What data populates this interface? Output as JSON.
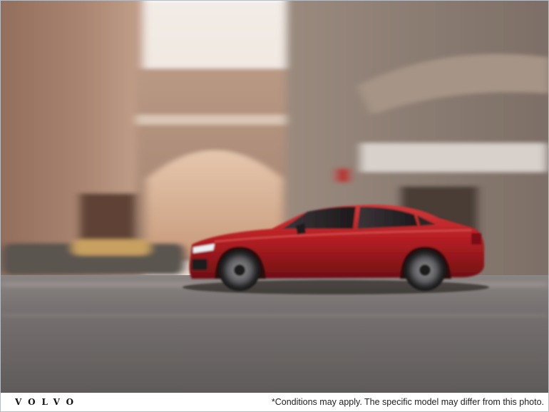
{
  "photo": {
    "subject": "red-sedan-icon",
    "colors": {
      "car_body": "#b51f24",
      "car_shadow": "#6e0f12",
      "road": "#6f6c6a",
      "sky": "#f1e9e2",
      "building_warm": "#b08068",
      "building_cool": "#8f8277"
    }
  },
  "footer": {
    "brand": "VOLVO",
    "disclaimer": "*Conditions may apply. The specific model may differ from this photo."
  }
}
